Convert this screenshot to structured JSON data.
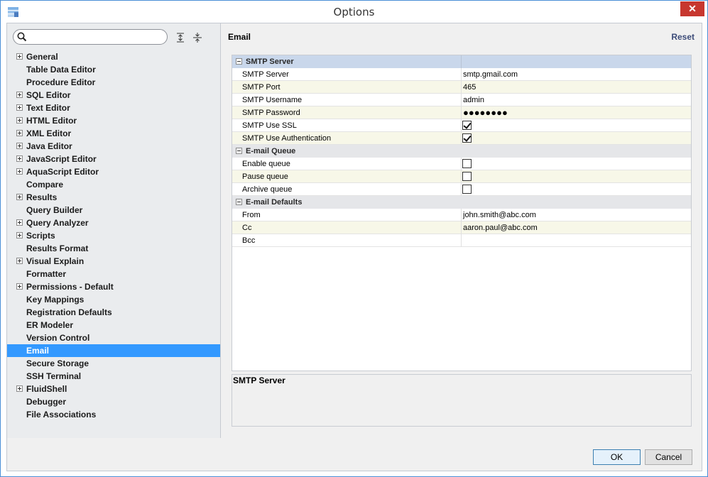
{
  "window": {
    "title": "Options",
    "close_glyph": "✕"
  },
  "search": {
    "placeholder": "",
    "value": ""
  },
  "sidebar": {
    "items": [
      {
        "label": "General",
        "expandable": true
      },
      {
        "label": "Table Data Editor",
        "expandable": false
      },
      {
        "label": "Procedure Editor",
        "expandable": false
      },
      {
        "label": "SQL Editor",
        "expandable": true
      },
      {
        "label": "Text Editor",
        "expandable": true
      },
      {
        "label": "HTML Editor",
        "expandable": true
      },
      {
        "label": "XML Editor",
        "expandable": true
      },
      {
        "label": "Java Editor",
        "expandable": true
      },
      {
        "label": "JavaScript Editor",
        "expandable": true
      },
      {
        "label": "AquaScript Editor",
        "expandable": true
      },
      {
        "label": "Compare",
        "expandable": false
      },
      {
        "label": "Results",
        "expandable": true
      },
      {
        "label": "Query Builder",
        "expandable": false
      },
      {
        "label": "Query Analyzer",
        "expandable": true
      },
      {
        "label": "Scripts",
        "expandable": true
      },
      {
        "label": "Results Format",
        "expandable": false
      },
      {
        "label": "Visual Explain",
        "expandable": true
      },
      {
        "label": "Formatter",
        "expandable": false
      },
      {
        "label": "Permissions - Default",
        "expandable": true
      },
      {
        "label": "Key Mappings",
        "expandable": false
      },
      {
        "label": "Registration Defaults",
        "expandable": false
      },
      {
        "label": "ER Modeler",
        "expandable": false
      },
      {
        "label": "Version Control",
        "expandable": false
      },
      {
        "label": "Email",
        "expandable": false,
        "selected": true
      },
      {
        "label": "Secure Storage",
        "expandable": false
      },
      {
        "label": "SSH Terminal",
        "expandable": false
      },
      {
        "label": "FluidShell",
        "expandable": true
      },
      {
        "label": "Debugger",
        "expandable": false
      },
      {
        "label": "File Associations",
        "expandable": false
      }
    ]
  },
  "panel": {
    "title": "Email",
    "reset_label": "Reset",
    "groups": [
      {
        "name": "SMTP Server",
        "rows": [
          {
            "label": "SMTP Server",
            "type": "text",
            "value": "smtp.gmail.com"
          },
          {
            "label": "SMTP Port",
            "type": "text",
            "value": "465"
          },
          {
            "label": "SMTP Username",
            "type": "text",
            "value": "admin"
          },
          {
            "label": "SMTP Password",
            "type": "password",
            "value": "●●●●●●●●"
          },
          {
            "label": "SMTP Use SSL",
            "type": "checkbox",
            "checked": true
          },
          {
            "label": "SMTP Use Authentication",
            "type": "checkbox",
            "checked": true
          }
        ]
      },
      {
        "name": "E-mail Queue",
        "rows": [
          {
            "label": "Enable queue",
            "type": "checkbox",
            "checked": false
          },
          {
            "label": "Pause queue",
            "type": "checkbox",
            "checked": false
          },
          {
            "label": "Archive queue",
            "type": "checkbox",
            "checked": false
          }
        ]
      },
      {
        "name": "E-mail Defaults",
        "rows": [
          {
            "label": "From",
            "type": "text",
            "value": "john.smith@abc.com"
          },
          {
            "label": "Cc",
            "type": "text",
            "value": "aaron.paul@abc.com"
          },
          {
            "label": "Bcc",
            "type": "text",
            "value": ""
          }
        ]
      }
    ],
    "description_title": "SMTP Server"
  },
  "buttons": {
    "ok": "OK",
    "cancel": "Cancel"
  },
  "colors": {
    "selection": "#3399ff",
    "close_button": "#c7372f",
    "reset_link": "#3d4c79",
    "alt_row": "#f7f7e8"
  },
  "icons": [
    "app-icon",
    "search-icon",
    "expand-all-icon",
    "collapse-all-icon",
    "close-icon",
    "checkmark-icon"
  ]
}
